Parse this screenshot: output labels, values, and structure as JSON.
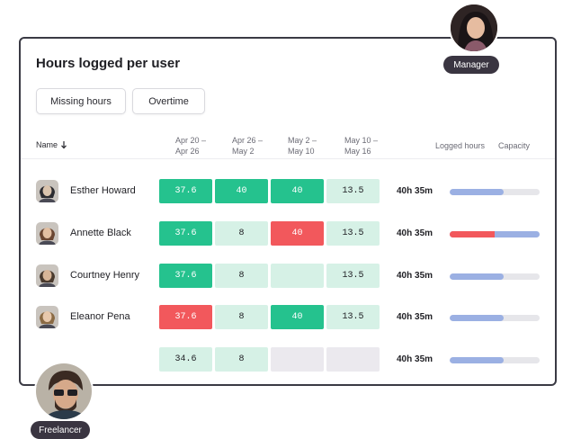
{
  "title": "Hours logged per user",
  "filters": [
    "Missing hours",
    "Overtime"
  ],
  "columns": {
    "name": "Name",
    "weeks": [
      {
        "line1": "Apr 20 –",
        "line2": "Apr 26"
      },
      {
        "line1": "Apr 26 –",
        "line2": "May 2"
      },
      {
        "line1": "May 2 –",
        "line2": "May 10"
      },
      {
        "line1": "May 10 –",
        "line2": "May 16"
      }
    ],
    "logged": "Logged hours",
    "capacity": "Capacity"
  },
  "rows": [
    {
      "name": "Esther Howard",
      "cells": [
        {
          "v": "37.6",
          "s": "green"
        },
        {
          "v": "40",
          "s": "green"
        },
        {
          "v": "40",
          "s": "green"
        },
        {
          "v": "13.5",
          "s": "light"
        }
      ],
      "logged": "40h 35m",
      "capacity": 0.6,
      "over": false
    },
    {
      "name": "Annette Black",
      "cells": [
        {
          "v": "37.6",
          "s": "green"
        },
        {
          "v": "8",
          "s": "light"
        },
        {
          "v": "40",
          "s": "red"
        },
        {
          "v": "13.5",
          "s": "light"
        }
      ],
      "logged": "40h 35m",
      "capacity": 0.5,
      "over": true
    },
    {
      "name": "Courtney Henry",
      "cells": [
        {
          "v": "37.6",
          "s": "green"
        },
        {
          "v": "8",
          "s": "light"
        },
        {
          "v": "",
          "s": "light"
        },
        {
          "v": "13.5",
          "s": "light"
        }
      ],
      "logged": "40h 35m",
      "capacity": 0.6,
      "over": false
    },
    {
      "name": "Eleanor Pena",
      "cells": [
        {
          "v": "37.6",
          "s": "red"
        },
        {
          "v": "8",
          "s": "light"
        },
        {
          "v": "40",
          "s": "green"
        },
        {
          "v": "13.5",
          "s": "light"
        }
      ],
      "logged": "40h 35m",
      "capacity": 0.6,
      "over": false
    },
    {
      "name": "",
      "cells": [
        {
          "v": "34.6",
          "s": "light"
        },
        {
          "v": "8",
          "s": "light"
        },
        {
          "v": "",
          "s": "gray"
        },
        {
          "v": "",
          "s": "gray"
        }
      ],
      "logged": "40h 35m",
      "capacity": 0.6,
      "over": false
    }
  ],
  "roles": {
    "manager": "Manager",
    "freelancer": "Freelancer"
  },
  "colors": {
    "green": "#25c28e",
    "light": "#d6f1e6",
    "red": "#f2585c",
    "gray": "#ebe9ee",
    "bar": "#9bb0e3",
    "bar_over": "#f2585c"
  }
}
